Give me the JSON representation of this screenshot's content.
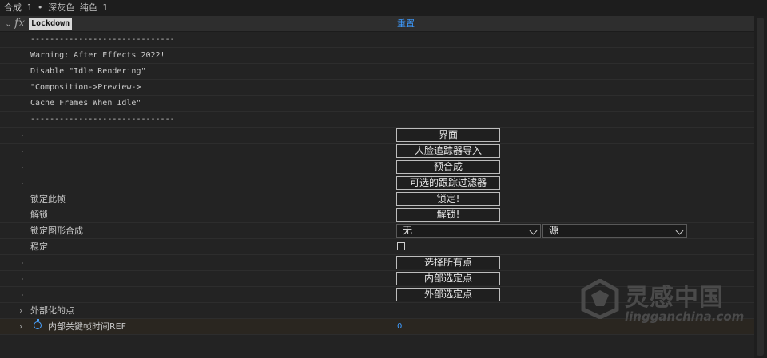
{
  "topbar": {
    "title": "合成 1 • 深灰色 纯色 1"
  },
  "effect": {
    "name": "Lockdown",
    "reset_label": "重置",
    "fx_label": "fx"
  },
  "info_lines": [
    "------------------------------",
    "Warning: After Effects 2022!",
    "Disable \"Idle Rendering\"",
    "\"Composition->Preview->",
    "Cache Frames When Idle\"",
    "------------------------------"
  ],
  "buttons": {
    "interface": "界面",
    "face_tracker_import": "人脸追踪器导入",
    "precomp": "预合成",
    "optional_tracker_filter": "可选的跟踪过滤器",
    "lock": "锁定!",
    "unlock": "解锁!",
    "select_all_points": "选择所有点",
    "inner_selected_points": "内部选定点",
    "outer_selected_points": "外部选定点"
  },
  "labels": {
    "lock_this_frame": "锁定此帧",
    "unlock": "解锁",
    "lock_shape_comp": "锁定图形合成",
    "stabilize": "稳定",
    "externalized_points": "外部化的点",
    "inner_keyframe_time_ref": "内部关键帧时间REF"
  },
  "selects": {
    "shape_comp_value": "无",
    "source_value": "源"
  },
  "values": {
    "inner_keyframe_time_ref": "0"
  },
  "watermark": {
    "cn": "灵感中国",
    "en": "lingganchina.com"
  }
}
